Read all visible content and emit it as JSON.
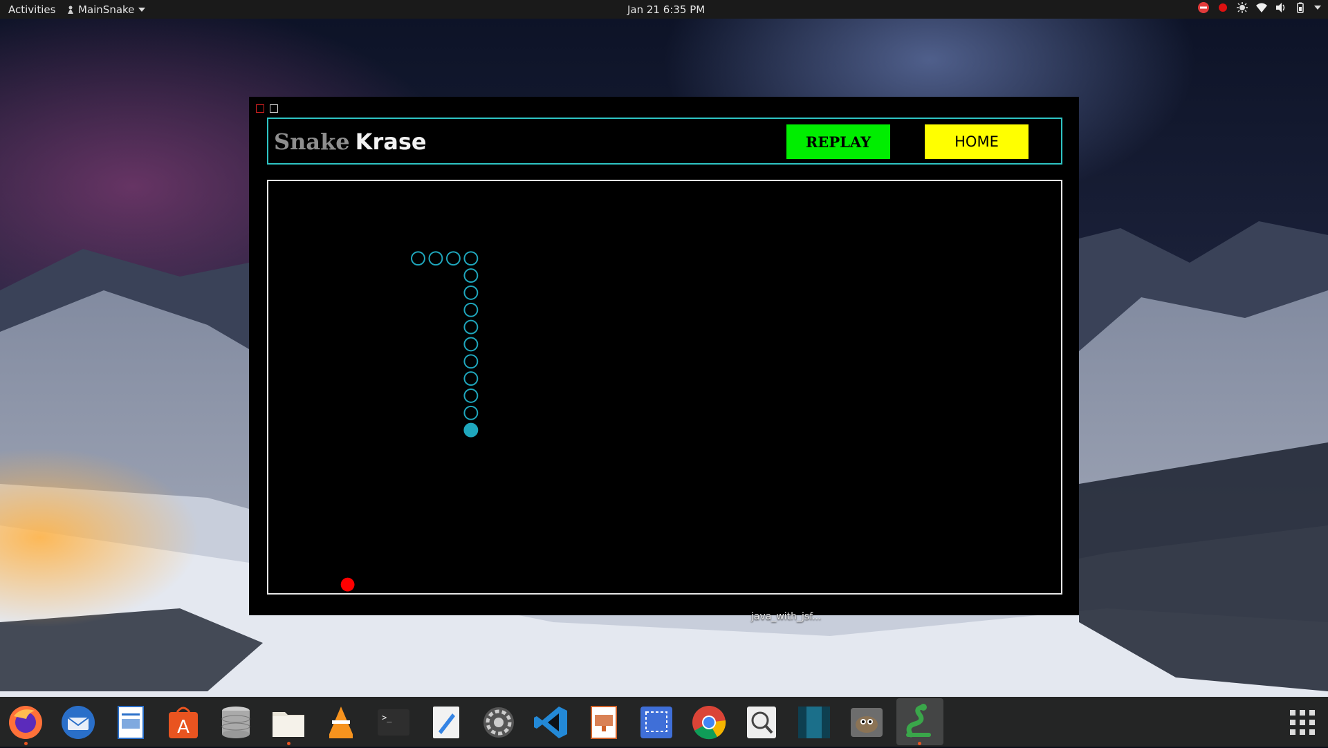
{
  "topbar": {
    "activities": "Activities",
    "app_menu": "MainSnake",
    "clock": "Jan 21  6:35 PM"
  },
  "game": {
    "title_part1": "Snake",
    "title_part2": "Krase",
    "replay_label": "REPLAY",
    "home_label": "HOME",
    "colors": {
      "frame": "#2ec4c4",
      "snake": "#1fa7bd",
      "food": "#ff0000",
      "replay_bg": "#00ee00",
      "home_bg": "#ffff00"
    },
    "grid": {
      "cols": 45,
      "rows": 24
    },
    "snake": [
      [
        8,
        4
      ],
      [
        9,
        4
      ],
      [
        10,
        4
      ],
      [
        11,
        4
      ],
      [
        11,
        5
      ],
      [
        11,
        6
      ],
      [
        11,
        7
      ],
      [
        11,
        8
      ],
      [
        11,
        9
      ],
      [
        11,
        10
      ],
      [
        11,
        11
      ],
      [
        11,
        12
      ],
      [
        11,
        13
      ],
      [
        11,
        14
      ]
    ],
    "snake_head_index": 13,
    "food": [
      4,
      23
    ]
  },
  "desktop": {
    "file_label": "java_with_jsf..."
  },
  "dock": {
    "items": [
      {
        "name": "firefox-icon"
      },
      {
        "name": "thunderbird-icon"
      },
      {
        "name": "writer-icon"
      },
      {
        "name": "software-center-icon"
      },
      {
        "name": "database-icon"
      },
      {
        "name": "files-icon"
      },
      {
        "name": "vlc-icon"
      },
      {
        "name": "terminal-icon"
      },
      {
        "name": "text-editor-icon"
      },
      {
        "name": "settings-icon"
      },
      {
        "name": "vscode-icon"
      },
      {
        "name": "impress-icon"
      },
      {
        "name": "screenshot-icon"
      },
      {
        "name": "chrome-icon"
      },
      {
        "name": "image-viewer-icon"
      },
      {
        "name": "panel-app-icon"
      },
      {
        "name": "gimp-icon"
      },
      {
        "name": "snake-app-icon"
      }
    ],
    "grid_button": "show-applications-icon"
  }
}
